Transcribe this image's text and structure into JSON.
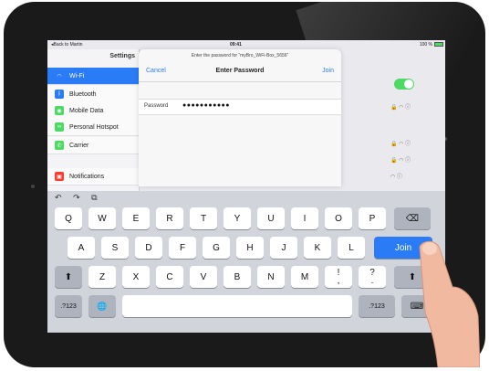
{
  "status": {
    "back": "◂Back to Martin",
    "time": "09:41",
    "battery": "100 %"
  },
  "sidebar": {
    "title": "Settings",
    "items": [
      {
        "label": "Wi-Fi",
        "icon": "wifi-icon",
        "color": "#2a7bf6"
      },
      {
        "label": "Bluetooth",
        "icon": "bluetooth-icon",
        "color": "#2a7bf6"
      },
      {
        "label": "Mobile Data",
        "icon": "mobile-data-icon",
        "color": "#4cd964"
      },
      {
        "label": "Personal Hotspot",
        "icon": "hotspot-icon",
        "color": "#4cd964"
      },
      {
        "label": "Carrier",
        "icon": "phone-icon",
        "color": "#4cd964"
      },
      {
        "label": "Notifications",
        "icon": "notifications-icon",
        "color": "#ff3b30"
      }
    ]
  },
  "modal": {
    "prompt": "Enter the password for “myBro_WiFi-Box_5656”",
    "cancel": "Cancel",
    "title": "Enter Password",
    "join": "Join",
    "password_label": "Password",
    "password_value": "●●●●●●●●●●●"
  },
  "keyboard": {
    "tools": [
      "↶",
      "↷",
      "⧉"
    ],
    "row1": [
      "Q",
      "W",
      "E",
      "R",
      "T",
      "Y",
      "U",
      "I",
      "O",
      "P"
    ],
    "backspace": "⌫",
    "row2": [
      "A",
      "S",
      "D",
      "F",
      "G",
      "H",
      "J",
      "K",
      "L"
    ],
    "join": "Join",
    "row3": [
      "Z",
      "X",
      "C",
      "V",
      "B",
      "N",
      "M",
      "!",
      "?"
    ],
    "row3_sub": [
      ",",
      "."
    ],
    "shift": "⬆",
    "num": ".?123",
    "globe": "🌐",
    "hide": "⌨"
  }
}
